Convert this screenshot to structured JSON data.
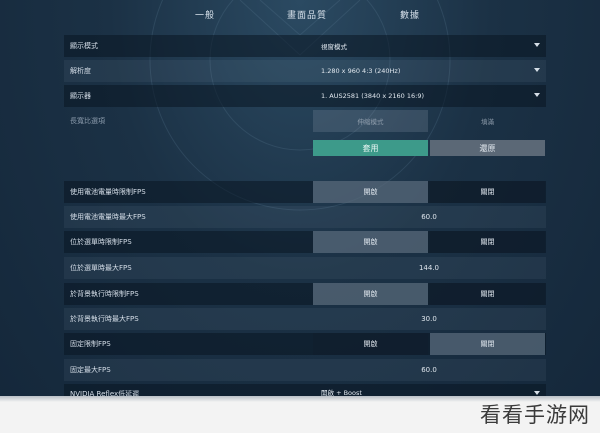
{
  "tabs": [
    "一般",
    "畫面品質",
    "數據"
  ],
  "settings": {
    "display_mode": {
      "label": "顯示模式",
      "value": "視窗模式"
    },
    "resolution": {
      "label": "解析度",
      "value": "1.280 x 960 4:3 (240Hz)"
    },
    "monitor": {
      "label": "顯示器",
      "value": "1. AUS2581 (3840 x 2160 16:9)"
    },
    "aspect": {
      "label": "長寬比選項",
      "option1": "伸縮模式",
      "option2": "填滿"
    },
    "apply_label": "套用",
    "restore_label": "還原",
    "battery_limit": {
      "label": "使用電池電量時限制FPS",
      "on": "開啟",
      "off": "關閉"
    },
    "battery_max": {
      "label": "使用電池電量時最大FPS",
      "value": "60.0"
    },
    "menu_limit": {
      "label": "位於選單時限制FPS",
      "on": "開啟",
      "off": "關閉"
    },
    "menu_max": {
      "label": "位於選單時最大FPS",
      "value": "144.0"
    },
    "bg_limit": {
      "label": "於背景執行時限制FPS",
      "on": "開啟",
      "off": "關閉"
    },
    "bg_max": {
      "label": "於背景執行時最大FPS",
      "value": "30.0"
    },
    "fixed_limit": {
      "label": "固定限制FPS",
      "on": "開啟",
      "off": "關閉"
    },
    "fixed_max": {
      "label": "固定最大FPS",
      "value": "60.0"
    },
    "reflex": {
      "label": "NVIDIA Reflex低延遲",
      "value": "開啟 + Boost"
    }
  },
  "watermark": "看看手游网"
}
